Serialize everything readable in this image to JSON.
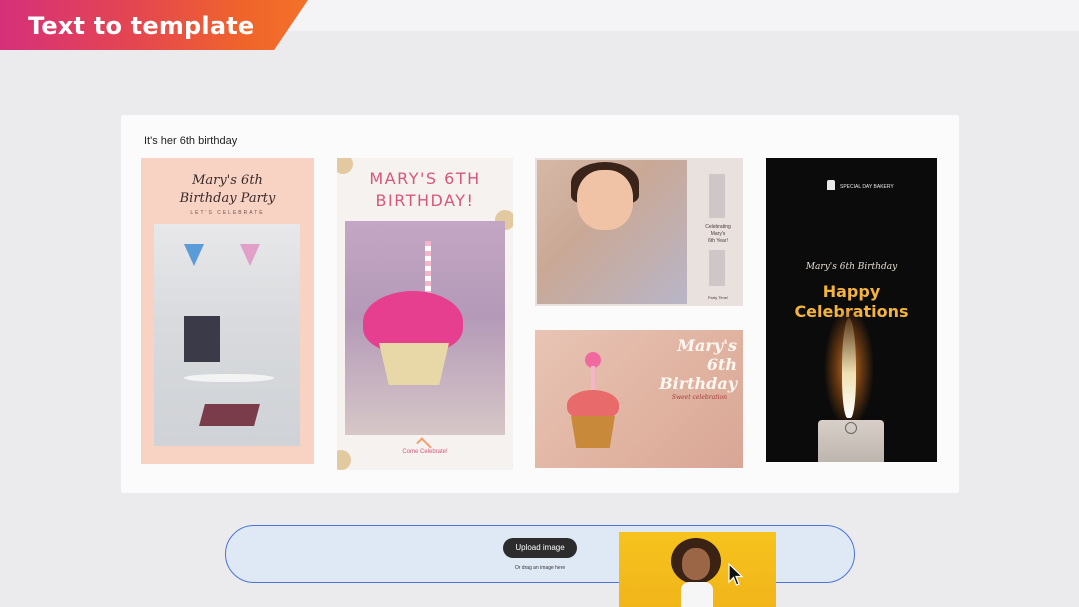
{
  "banner": {
    "title": "Text to template"
  },
  "panel": {
    "prompt": "It's her 6th birthday",
    "cards": [
      {
        "title_line1": "Mary's 6th",
        "title_line2": "Birthday Party",
        "subtitle": "LET'S CELEBRATE"
      },
      {
        "title_line1": "MARY'S 6TH",
        "title_line2": "BIRTHDAY!",
        "footer": "Come Celebrate!"
      },
      {
        "line1": "Celebrating",
        "line2": "Mary's",
        "line3": "6th Year!",
        "footer": "Party Time!"
      },
      {
        "title_line1": "Mary's",
        "title_line2": "6th",
        "title_line3": "Birthday",
        "subtitle": "Sweet celebration"
      },
      {
        "brand": "SPECIAL DAY BAKERY",
        "script": "Mary's 6th Birthday",
        "headline_line1": "Happy",
        "headline_line2": "Celebrations"
      }
    ]
  },
  "upload": {
    "button_label": "Upload image",
    "hint": "Or drag an image here"
  },
  "colors": {
    "banner_start": "#d6307a",
    "banner_end": "#f3712a",
    "upload_border": "#4a74d8",
    "upload_bg": "#dfe9f6"
  }
}
